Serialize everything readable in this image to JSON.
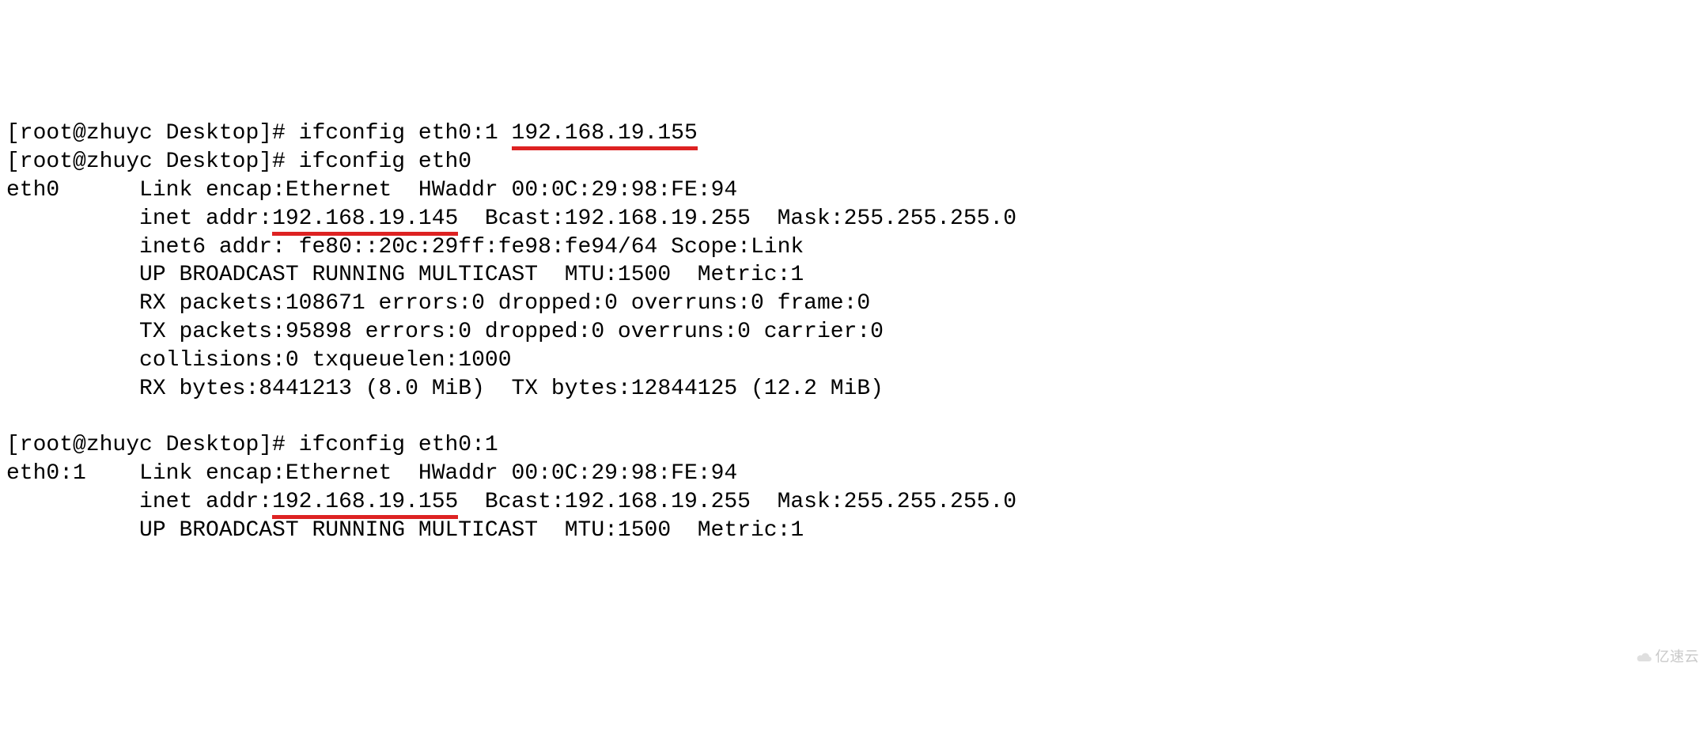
{
  "prompt": "[root@zhuyc Desktop]# ",
  "cmd1_prefix": "ifconfig eth0:1 ",
  "cmd1_ip": "192.168.19.155",
  "cmd2": "ifconfig eth0",
  "eth0": {
    "name": "eth0",
    "link_line": "Link encap:Ethernet  HWaddr 00:0C:29:98:FE:94",
    "inet_prefix": "inet addr:",
    "inet_ip": "192.168.19.145",
    "inet_rest": "  Bcast:192.168.19.255  Mask:255.255.255.0",
    "inet6": "inet6 addr: fe80::20c:29ff:fe98:fe94/64 Scope:Link",
    "flags": "UP BROADCAST RUNNING MULTICAST  MTU:1500  Metric:1",
    "rx_packets": "RX packets:108671 errors:0 dropped:0 overruns:0 frame:0",
    "tx_packets": "TX packets:95898 errors:0 dropped:0 overruns:0 carrier:0",
    "collisions": "collisions:0 txqueuelen:1000",
    "bytes": "RX bytes:8441213 (8.0 MiB)  TX bytes:12844125 (12.2 MiB)"
  },
  "cmd3": "ifconfig eth0:1",
  "eth01": {
    "name": "eth0:1",
    "link_line": "Link encap:Ethernet  HWaddr 00:0C:29:98:FE:94",
    "inet_prefix": "inet addr:",
    "inet_ip": "192.168.19.155",
    "inet_rest": "  Bcast:192.168.19.255  Mask:255.255.255.0",
    "flags": "UP BROADCAST RUNNING MULTICAST  MTU:1500  Metric:1"
  },
  "indent_iface": "      ",
  "indent_body": "          ",
  "watermark": "亿速云"
}
